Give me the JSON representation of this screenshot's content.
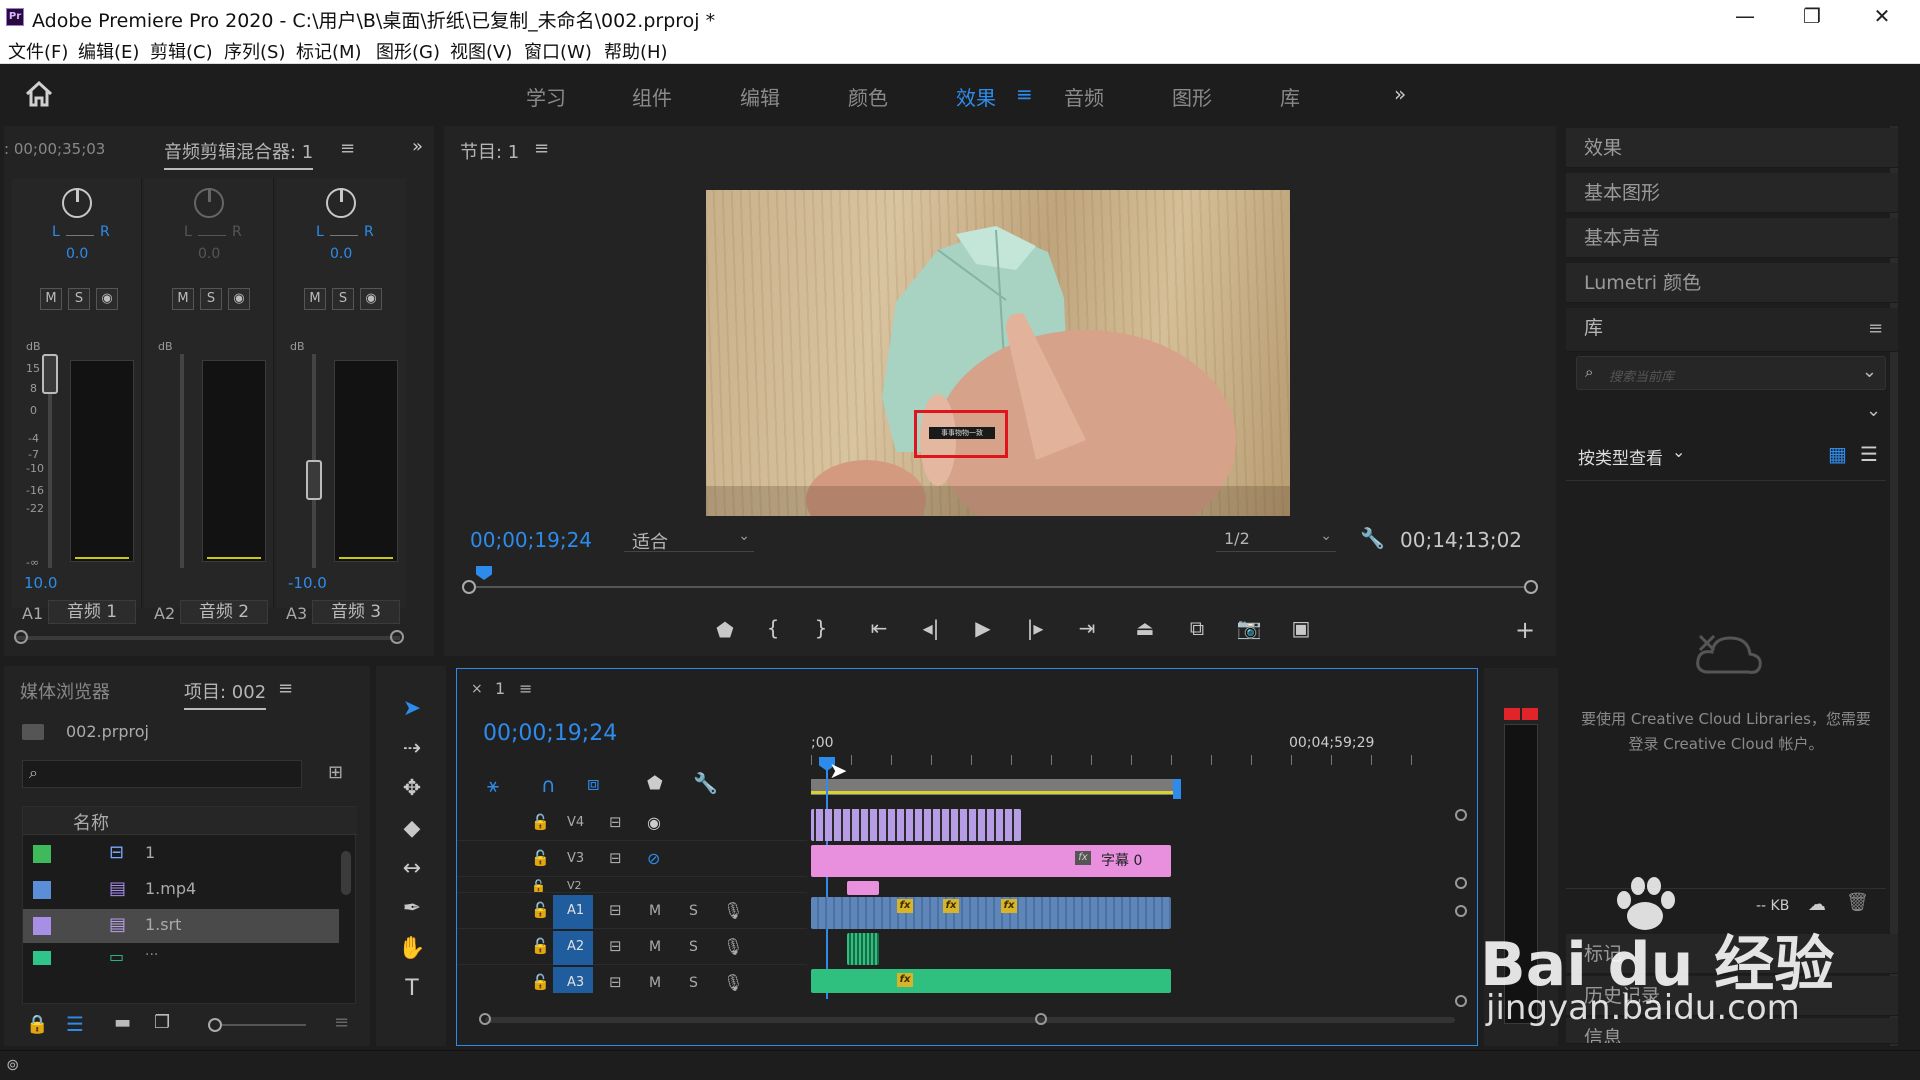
{
  "window": {
    "app_icon": "Pr",
    "title": "Adobe Premiere Pro 2020 - C:\\用户\\B\\桌面\\折纸\\已复制_未命名\\002.prproj *",
    "minimize": "—",
    "maximize": "❐",
    "close": "✕"
  },
  "menu": [
    "文件(F)",
    "编辑(E)",
    "剪辑(C)",
    "序列(S)",
    "标记(M)",
    "图形(G)",
    "视图(V)",
    "窗口(W)",
    "帮助(H)"
  ],
  "workspaces": {
    "tabs": [
      "学习",
      "组件",
      "编辑",
      "颜色",
      "效果",
      "音频",
      "图形",
      "库"
    ],
    "active": "效果",
    "more": "»"
  },
  "audio_mixer": {
    "timecode": ": 00;00;35;03",
    "tab_label": "音频剪辑混合器: 1",
    "more": "»",
    "channels": [
      {
        "pan": "0.0",
        "level": "10.0",
        "id": "A1",
        "name": "音频 1",
        "dim": false
      },
      {
        "pan": "0.0",
        "level": "",
        "id": "A2",
        "name": "音频 2",
        "dim": true
      },
      {
        "pan": "0.0",
        "level": "-10.0",
        "id": "A3",
        "name": "音频 3",
        "dim": false
      }
    ],
    "pan_l": "L",
    "pan_r": "R",
    "buttons": [
      "M",
      "S",
      "◉"
    ],
    "db_label": "dB",
    "scale": [
      "15",
      "8",
      "0",
      "-4",
      "-7",
      "-10",
      "-16",
      "-22",
      "-∞"
    ]
  },
  "program_monitor": {
    "tab_label": "节目: 1",
    "timecode": "00;00;19;24",
    "fit": "适合",
    "resolution": "1/2",
    "duration": "00;14;13;02",
    "subtitle_text": "事事物物一致"
  },
  "project_panel": {
    "tab_media": "媒体浏览器",
    "tab_project": "项目: 002",
    "file": "002.prproj",
    "col_name": "名称",
    "items": [
      {
        "name": "1",
        "color": "#3fba5a"
      },
      {
        "name": "1.mp4",
        "color": "#5a8ed8"
      },
      {
        "name": "1.srt",
        "color": "#a78fe6"
      },
      {
        "name": "···",
        "color": "#2fc48a"
      }
    ]
  },
  "timeline": {
    "tab_label": "1",
    "timecode": "00;00;19;24",
    "ruler_start": ";00",
    "ruler_end": "00;04;59;29",
    "tracks": [
      {
        "id": "V4",
        "type": "video"
      },
      {
        "id": "V3",
        "type": "video"
      },
      {
        "id": "V2",
        "type": "video"
      },
      {
        "id": "A1",
        "type": "audio"
      },
      {
        "id": "A2",
        "type": "audio"
      },
      {
        "id": "A3",
        "type": "audio"
      }
    ],
    "subtitle_clip": "字幕 0",
    "mute": "M",
    "solo": "S"
  },
  "side_panel": {
    "items": [
      "效果",
      "基本图形",
      "基本声音",
      "Lumetri 颜色",
      "库"
    ],
    "search_placeholder": "搜索当前库",
    "view_by": "按类型查看",
    "cc_message_1": "要使用 Creative Cloud Libraries，您需要",
    "cc_message_2": "登录 Creative Cloud 帐户。",
    "kb": "-- KB",
    "bottom_items": [
      "标记",
      "历史记录",
      "信息"
    ]
  },
  "watermark": {
    "brand": "Bai du 经验",
    "url": "jingyan.baidu.com"
  },
  "colors": {
    "accent": "#2d8ceb",
    "video_clip": "#b79de6",
    "subtitle_clip": "#e890de",
    "audio_clip": "#5f86b8",
    "audio_clip_green": "#2fbf7f"
  }
}
